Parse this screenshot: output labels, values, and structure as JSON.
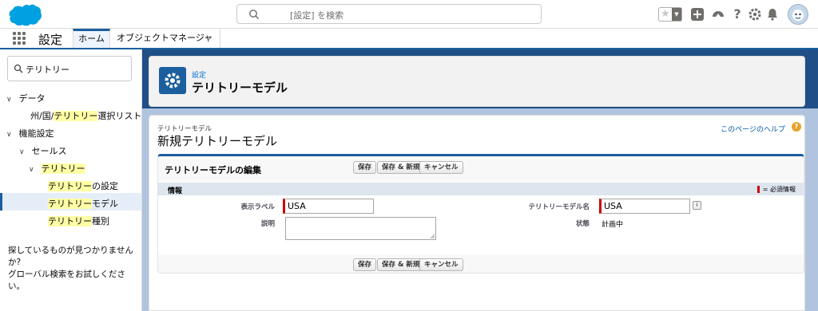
{
  "header": {
    "search_placeholder": "[設定] を検索",
    "colors": {
      "brand": "#00a1e0",
      "accent": "#1b5f9e"
    }
  },
  "nav": {
    "app_name": "設定",
    "tabs": [
      {
        "label": "ホーム"
      },
      {
        "label": "オブジェクトマネージャ"
      }
    ]
  },
  "sidebar": {
    "quick_find_value": "テリトリー",
    "tree": {
      "data": "データ",
      "state_country_prefix": "州/国/",
      "territory_hl": "テリトリー",
      "state_country_suffix": "選択リスト",
      "feature_settings": "機能設定",
      "sales": "セールス",
      "territory": "テリトリー",
      "settings_suffix": "の設定",
      "model_suffix": "モデル",
      "type_suffix": "種別"
    },
    "help_line1": "探しているものが見つかりませんか?",
    "help_line2": "グローバル検索をお試しください。"
  },
  "page_header": {
    "subtitle": "設定",
    "title": "テリトリーモデル"
  },
  "content": {
    "subtitle": "テリトリーモデル",
    "title": "新規テリトリーモデル",
    "help_link": "このページのヘルプ",
    "help_icon": "?"
  },
  "block": {
    "title": "テリトリーモデルの編集",
    "buttons": {
      "save": "保存",
      "save_new": "保存 & 新規",
      "cancel": "キャンセル"
    },
    "section_title": "情報",
    "required_legend": "= 必須情報",
    "fields": {
      "display_label": {
        "label": "表示ラベル",
        "value": "USA"
      },
      "description": {
        "label": "説明",
        "value": ""
      },
      "model_name": {
        "label": "テリトリーモデル名",
        "value": "USA"
      },
      "state": {
        "label": "状態",
        "value": "計画中"
      }
    }
  }
}
